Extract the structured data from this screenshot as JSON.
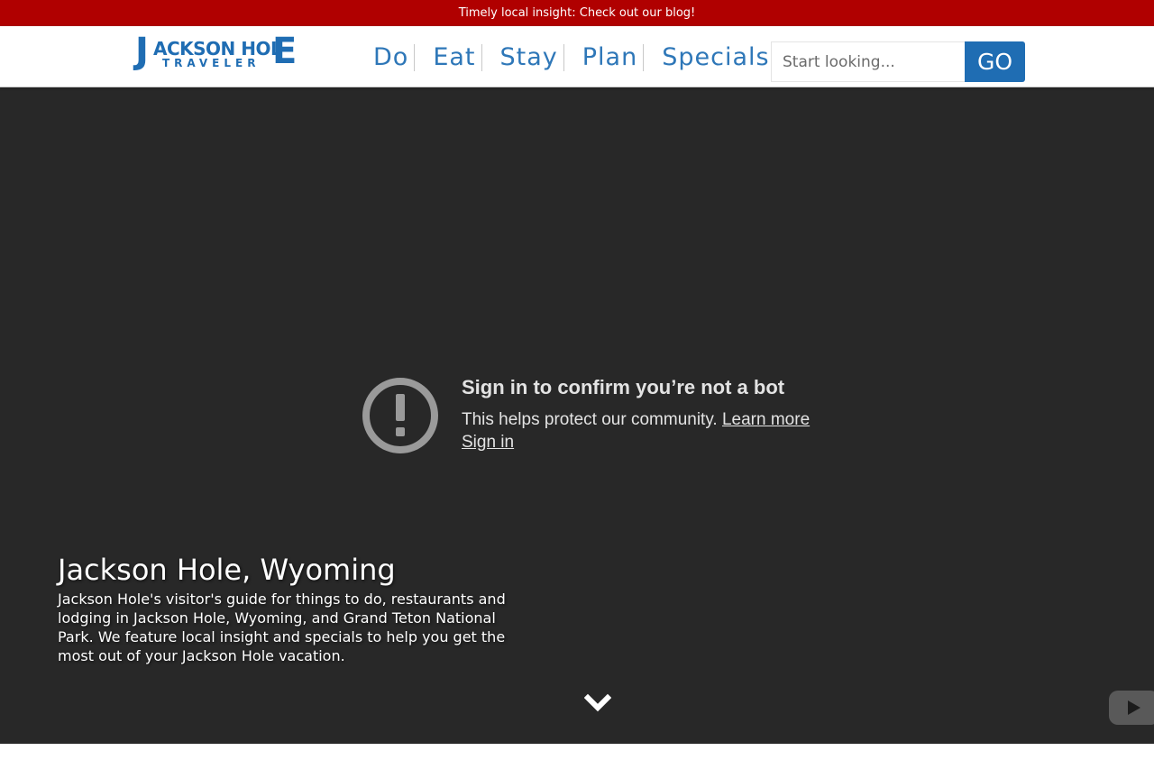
{
  "banner": {
    "text": "Timely local insight: Check out our blog!"
  },
  "header": {
    "logo": {
      "first_letter": "J",
      "main": "ACKSON HOL",
      "last_letter": "E",
      "sub": "TRAVELER"
    },
    "nav": [
      {
        "label": "Do"
      },
      {
        "label": "Eat"
      },
      {
        "label": "Stay"
      },
      {
        "label": "Plan"
      },
      {
        "label": "Specials"
      }
    ],
    "search": {
      "placeholder": "Start looking...",
      "value": "",
      "go_label": "GO"
    },
    "colors": {
      "brand_blue": "#1f6db3",
      "banner_red": "#b00000"
    }
  },
  "video": {
    "title": "Sign in to confirm you’re not a bot",
    "description": "This helps protect our community.",
    "learn_more": "Learn more",
    "sign_in": "Sign in",
    "icon": "alert-circle-icon",
    "play_icon": "youtube-play-icon"
  },
  "hero": {
    "title": "Jackson Hole, Wyoming",
    "description": "Jackson Hole's visitor's guide for things to do, restaurants and lodging in Jackson Hole, Wyoming, and Grand Teton National Park. We feature local insight and specials to help you get the most out of your Jackson Hole vacation.",
    "scroll_icon": "chevron-down-icon"
  }
}
